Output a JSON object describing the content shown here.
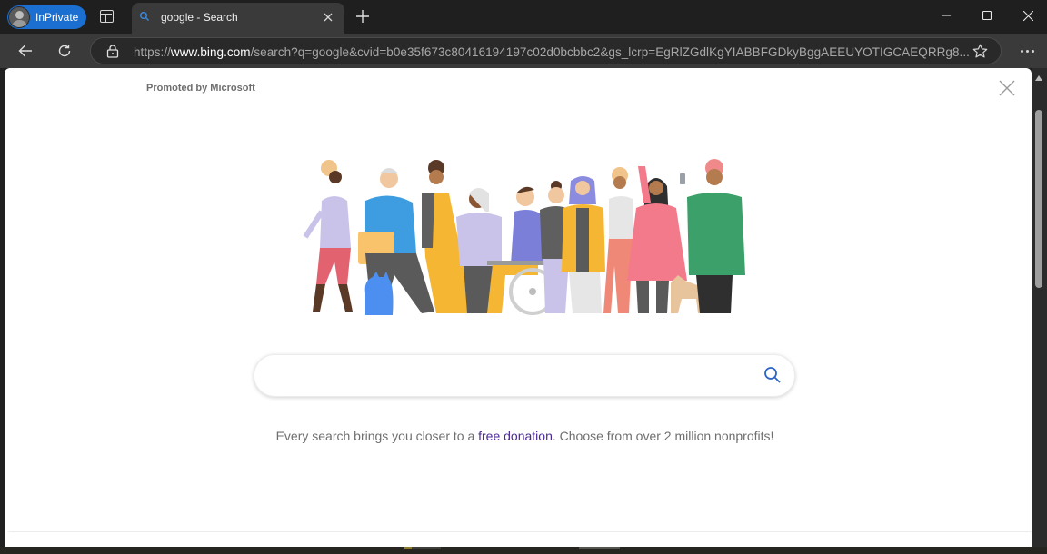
{
  "browser": {
    "inprivate_label": "InPrivate",
    "tab": {
      "title": "google - Search",
      "favicon": "search-icon"
    },
    "new_tab_icon": "plus-icon",
    "window_controls": [
      "minimize-icon",
      "maximize-icon",
      "close-icon"
    ],
    "toolbar": {
      "back_icon": "arrow-left-icon",
      "refresh_icon": "refresh-icon",
      "lock_icon": "lock-icon",
      "url_prefix": "https://",
      "url_domain": "www.bing.com",
      "url_rest": "/search?q=google&cvid=b0e35f673c80416194197c02d0bcbbc2&gs_lcrp=EgRlZGdlKgYIABBFGDkyBggAEEUYOTIGCAEQRRg8...",
      "favorite_icon": "star-icon",
      "more_icon": "ellipsis-icon"
    }
  },
  "page": {
    "promoted_label": "Promoted by Microsoft",
    "close_icon": "close-icon",
    "illustration": "diverse-people-illustration",
    "search": {
      "value": "",
      "placeholder": "",
      "icon": "search-icon"
    },
    "tagline": {
      "before": "Every search brings you closer to a ",
      "link": "free donation",
      "after": ". Choose from over 2 million nonprofits!"
    }
  },
  "colors": {
    "inprivate_badge": "#1a6fd0",
    "link": "#4b2a93",
    "search_icon": "#2b66c4"
  }
}
